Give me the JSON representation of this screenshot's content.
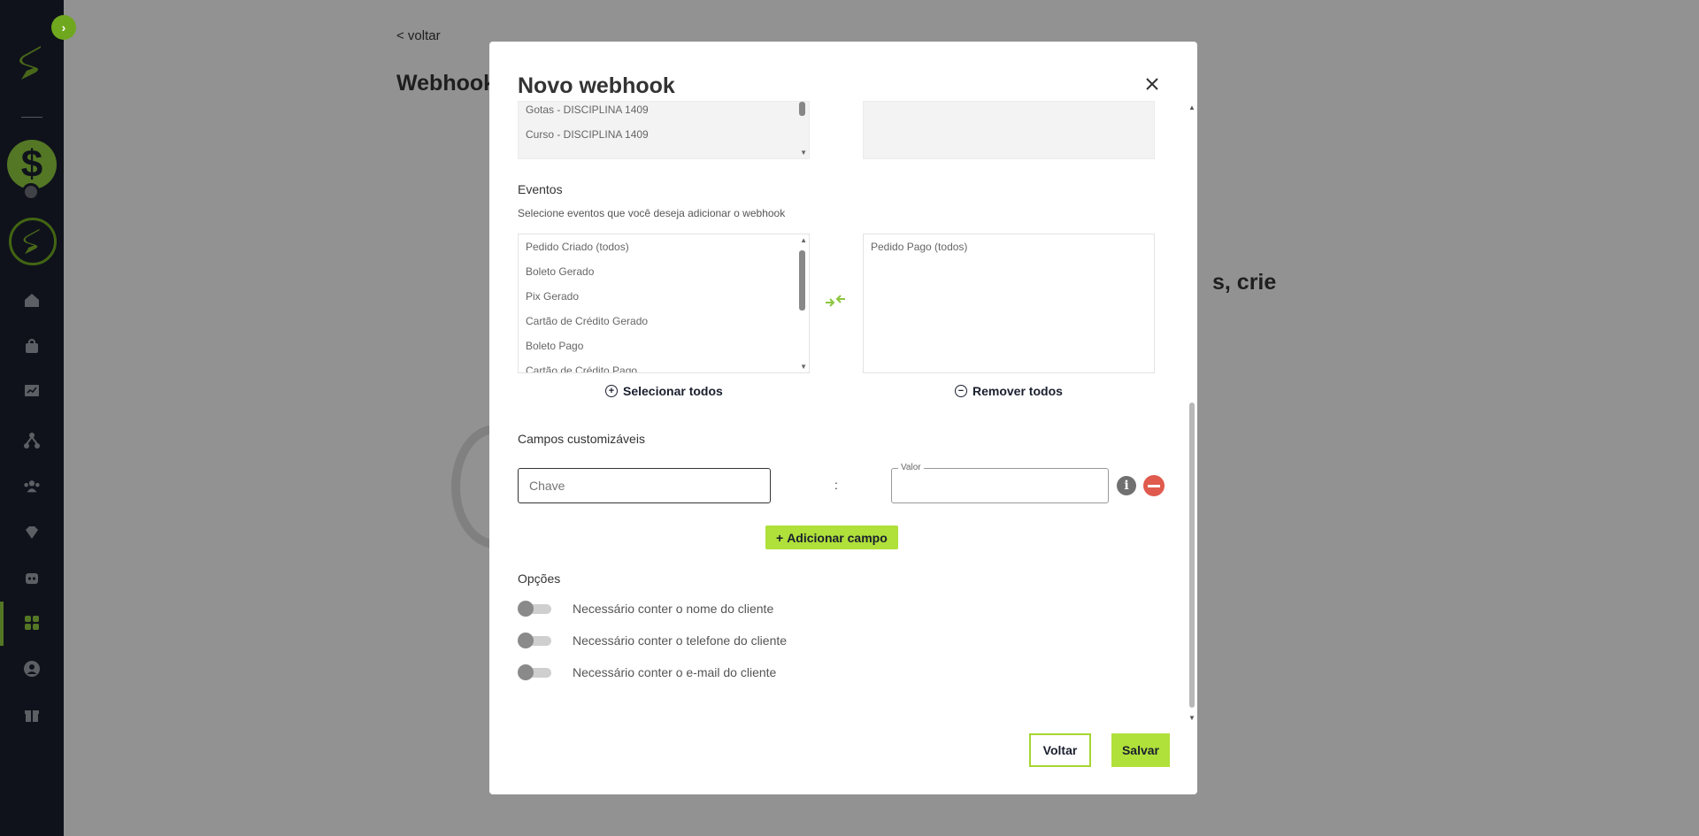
{
  "background": {
    "back_link": "< voltar",
    "title": "Webhook",
    "partial_heading": "s, crie"
  },
  "modal": {
    "title": "Novo webhook",
    "top_source_list": [
      "Gotas - DISCIPLINA 1409",
      "Curso - DISCIPLINA 1409"
    ],
    "events": {
      "label": "Eventos",
      "subtitle": "Selecione eventos que você deseja adicionar o webhook",
      "available": [
        "Pedido Criado (todos)",
        "Boleto Gerado",
        "Pix Gerado",
        "Cartão de Crédito Gerado",
        "Boleto Pago",
        "Cartão de Crédito Pago"
      ],
      "selected": [
        "Pedido Pago (todos)"
      ],
      "select_all": "Selecionar todos",
      "remove_all": "Remover todos"
    },
    "custom_fields": {
      "label": "Campos customizáveis",
      "key_placeholder": "Chave",
      "separator": ":",
      "value_label": "Valor",
      "add_button": "Adicionar campo"
    },
    "options": {
      "label": "Opções",
      "items": [
        {
          "label": "Necessário conter o nome do cliente",
          "enabled": false
        },
        {
          "label": "Necessário conter o telefone do cliente",
          "enabled": false
        },
        {
          "label": "Necessário conter o e-mail do cliente",
          "enabled": false
        }
      ]
    },
    "footer": {
      "back": "Voltar",
      "save": "Salvar"
    }
  },
  "colors": {
    "accent": "#b0e03a",
    "sidebar": "#1a1f2e",
    "danger": "#e05a4e"
  }
}
